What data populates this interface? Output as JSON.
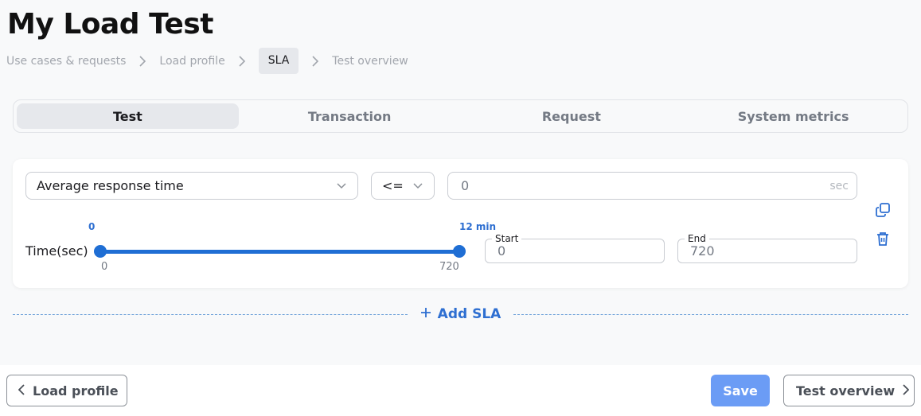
{
  "page": {
    "title": "My Load Test"
  },
  "breadcrumb": {
    "items": [
      {
        "label": "Use cases & requests"
      },
      {
        "label": "Load profile"
      },
      {
        "label": "SLA"
      },
      {
        "label": "Test overview"
      }
    ]
  },
  "tabs": [
    {
      "label": "Test",
      "active": true
    },
    {
      "label": "Transaction"
    },
    {
      "label": "Request"
    },
    {
      "label": "System metrics"
    }
  ],
  "sla": {
    "metric": "Average response time",
    "operator": "<=",
    "value": "0",
    "unit": "sec",
    "time_label": "Time(sec)",
    "slider": {
      "start_caption": "0",
      "end_caption": "12 min",
      "min_label": "0",
      "max_label": "720",
      "range_start": 0,
      "range_end": 720
    },
    "start": {
      "label": "Start",
      "value": "0"
    },
    "end": {
      "label": "End",
      "value": "720"
    },
    "icons": {
      "copy": "copy-icon",
      "delete": "trash-icon"
    }
  },
  "add_sla": {
    "label": "Add SLA",
    "icon": "plus-icon"
  },
  "footer": {
    "back_label": "Load profile",
    "save_label": "Save",
    "next_label": "Test overview"
  },
  "colors": {
    "accent": "#1f6ed4",
    "save_button": "#6b9cf5",
    "active_tab_bg": "#e6e8ec"
  }
}
